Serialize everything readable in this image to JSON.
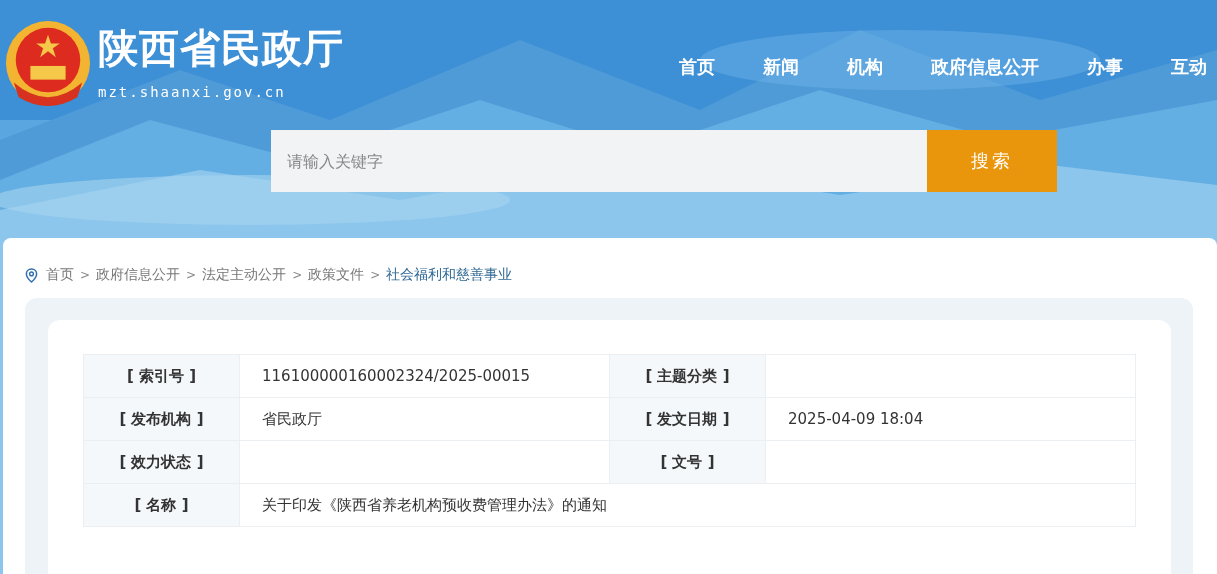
{
  "header": {
    "site_name": "陕西省民政厅",
    "domain": "mzt.shaanxi.gov.cn",
    "nav": [
      "首页",
      "新闻",
      "机构",
      "政府信息公开",
      "办事",
      "互动"
    ],
    "search": {
      "placeholder": "请输入关键字",
      "button": "搜索"
    }
  },
  "breadcrumb": [
    "首页",
    "政府信息公开",
    "法定主动公开",
    "政策文件",
    "社会福利和慈善事业"
  ],
  "breadcrumb_separator": ">",
  "info_table": {
    "rows": [
      {
        "cells": [
          {
            "label": "[ 索引号 ]",
            "value": "116100000160002324/2025-00015"
          },
          {
            "label": "[ 主题分类 ]"
          }
        ]
      },
      {
        "cells": [
          {
            "label": "[ 发布机构 ]",
            "value": "省民政厅"
          },
          {
            "label": "[ 发文日期 ]",
            "value": "2025-04-09 18:04"
          }
        ]
      },
      {
        "cells": [
          {
            "label": "[ 效力状态 ]"
          },
          {
            "label": "[ 文号 ]"
          }
        ]
      },
      {
        "cells": [
          {
            "label": "[ 名称 ]",
            "value": "关于印发《陕西省养老机构预收费管理办法》的通知"
          }
        ]
      }
    ]
  }
}
